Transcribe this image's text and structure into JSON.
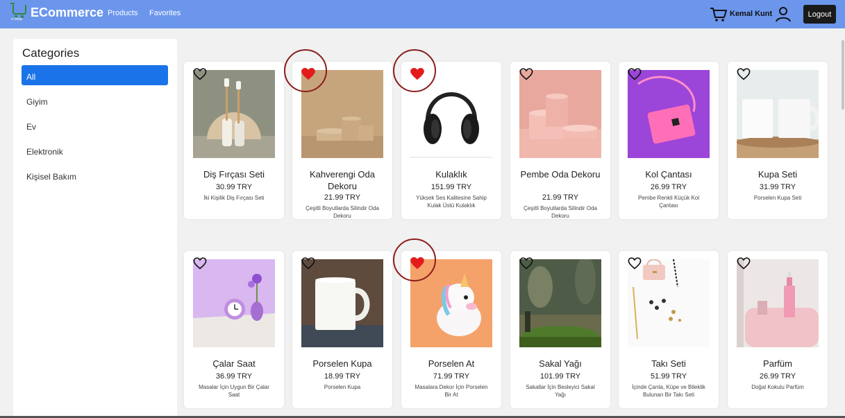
{
  "nav": {
    "brand": "ECommerce",
    "brand_sub": "e-Shop",
    "links": [
      "Products",
      "Favorites"
    ],
    "user_name": "Kemal Kunt",
    "logout_label": "Logout",
    "bar_color": "#6b96ec"
  },
  "sidebar": {
    "title": "Categories",
    "items": [
      "All",
      "Giyim",
      "Ev",
      "Elektronik",
      "Kişisel Bakım"
    ],
    "active": "All"
  },
  "products": [
    {
      "name": "Diş Fırçası Seti",
      "price": "30.99 TRY",
      "desc": "İki Kişilik Diş Fırçası Seti",
      "favorite": false,
      "highlighted": false,
      "icon": "toothbrush-set"
    },
    {
      "name": "Kahverengi Oda Dekoru",
      "price": "21.99 TRY",
      "desc": "Çeşitli Boyutlarda Silindir Oda Dekoru",
      "favorite": true,
      "highlighted": true,
      "icon": "brown-cylinders"
    },
    {
      "name": "Kulaklık",
      "price": "151.99 TRY",
      "desc": "Yüksek Ses Kalitesine Sahip Kulak Üstü Kulaklık",
      "favorite": true,
      "highlighted": true,
      "icon": "headphones"
    },
    {
      "name": "Pembe Oda Dekoru",
      "price": "21.99 TRY",
      "desc": "Çeşitli Boyutlarda Silindir Oda Dekoru",
      "favorite": false,
      "highlighted": false,
      "icon": "pink-cylinders"
    },
    {
      "name": "Kol Çantası",
      "price": "26.99 TRY",
      "desc": "Pembe Renkli Küçük Kol Çantası",
      "favorite": false,
      "highlighted": false,
      "icon": "pink-bag"
    },
    {
      "name": "Kupa Seti",
      "price": "31.99 TRY",
      "desc": "Porselen Kupa Seti",
      "favorite": false,
      "highlighted": false,
      "icon": "mug-set"
    },
    {
      "name": "Çalar Saat",
      "price": "36.99 TRY",
      "desc": "Masalar İçin Uygun Bir Çalar Saat",
      "favorite": false,
      "highlighted": false,
      "icon": "alarm-clock"
    },
    {
      "name": "Porselen Kupa",
      "price": "18.99 TRY",
      "desc": "Porselen Kupa",
      "favorite": false,
      "highlighted": false,
      "icon": "white-mug"
    },
    {
      "name": "Porselen At",
      "price": "71.99 TRY",
      "desc": "Masalara Dekor İçin Porselen Bir At",
      "favorite": true,
      "highlighted": true,
      "icon": "unicorn"
    },
    {
      "name": "Sakal Yağı",
      "price": "101.99 TRY",
      "desc": "Sakallar İçin Besleyici Sakal Yağı",
      "favorite": false,
      "highlighted": false,
      "icon": "beard-oil"
    },
    {
      "name": "Takı Seti",
      "price": "51.99 TRY",
      "desc": "İçinde Çanta, Küpe ve Bileklik Bulunan Bir Takı Seti",
      "favorite": false,
      "highlighted": false,
      "icon": "jewelry"
    },
    {
      "name": "Parfüm",
      "price": "26.99 TRY",
      "desc": "Doğal Kokulu Parfüm",
      "favorite": false,
      "highlighted": false,
      "icon": "perfume"
    }
  ]
}
